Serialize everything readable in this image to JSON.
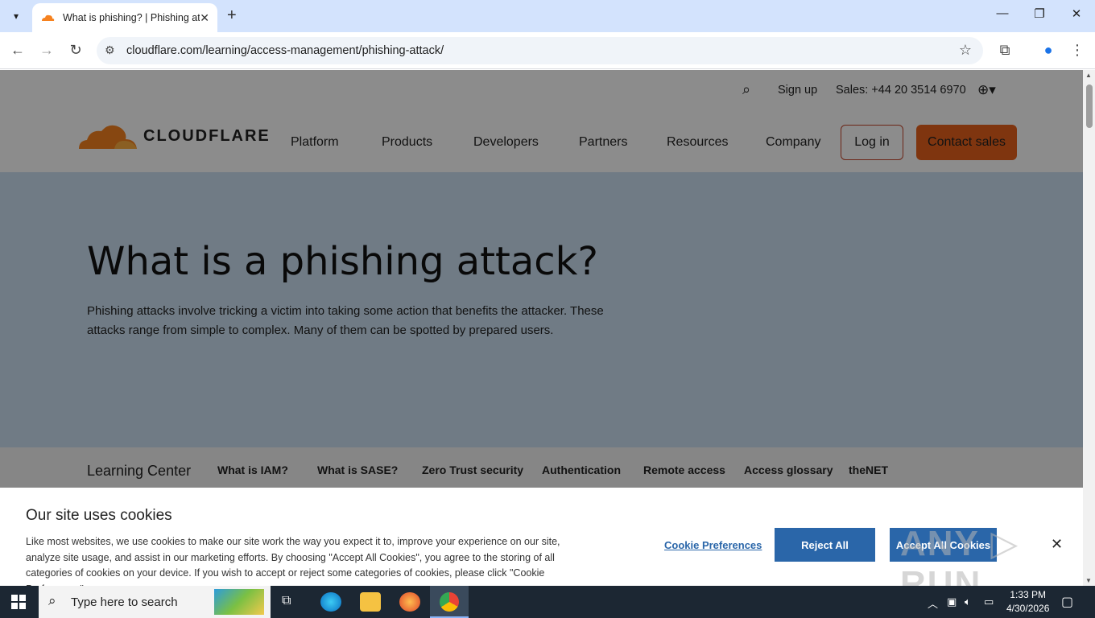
{
  "browser": {
    "tab_title": "What is phishing? | Phishing att",
    "url": "cloudflare.com/learning/access-management/phishing-attack/"
  },
  "header": {
    "sign_up": "Sign up",
    "sales": "Sales: +44 20 3514 6970",
    "logo_text": "CLOUDFLARE",
    "nav": [
      "Platform",
      "Products",
      "Developers",
      "Partners",
      "Resources",
      "Company"
    ],
    "login": "Log in",
    "contact": "Contact sales"
  },
  "hero": {
    "title": "What is a phishing attack?",
    "description": "Phishing attacks involve tricking a victim into taking some action that benefits the attacker. These attacks range from simple to complex. Many of them can be spotted by prepared users."
  },
  "learning_center": {
    "title": "Learning Center",
    "links": [
      "What is IAM?",
      "What is SASE?",
      "Zero Trust security",
      "Authentication",
      "Remote access",
      "Access glossary",
      "theNET"
    ]
  },
  "cookie_banner": {
    "title": "Our site uses cookies",
    "text": "Like most websites, we use cookies to make our site work the way you expect it to, improve your experience on our site, analyze site usage, and assist in our marketing efforts. By choosing \"Accept All Cookies\", you agree to the storing of all categories of cookies on your device. If you wish to accept or reject some categories of cookies, please click \"Cookie Preferences\".",
    "preferences": "Cookie Preferences",
    "reject": "Reject All",
    "accept": "Accept All Cookies",
    "close": "✕",
    "watermark": "ANY ▷ RUN"
  },
  "taskbar": {
    "search_placeholder": "Type here to search",
    "time": "1:33 PM",
    "date": "4/30/2026"
  },
  "colors": {
    "brand_orange": "#f6821f",
    "button_blue": "#2a66a9",
    "hero_bg": "#cce0f2"
  }
}
